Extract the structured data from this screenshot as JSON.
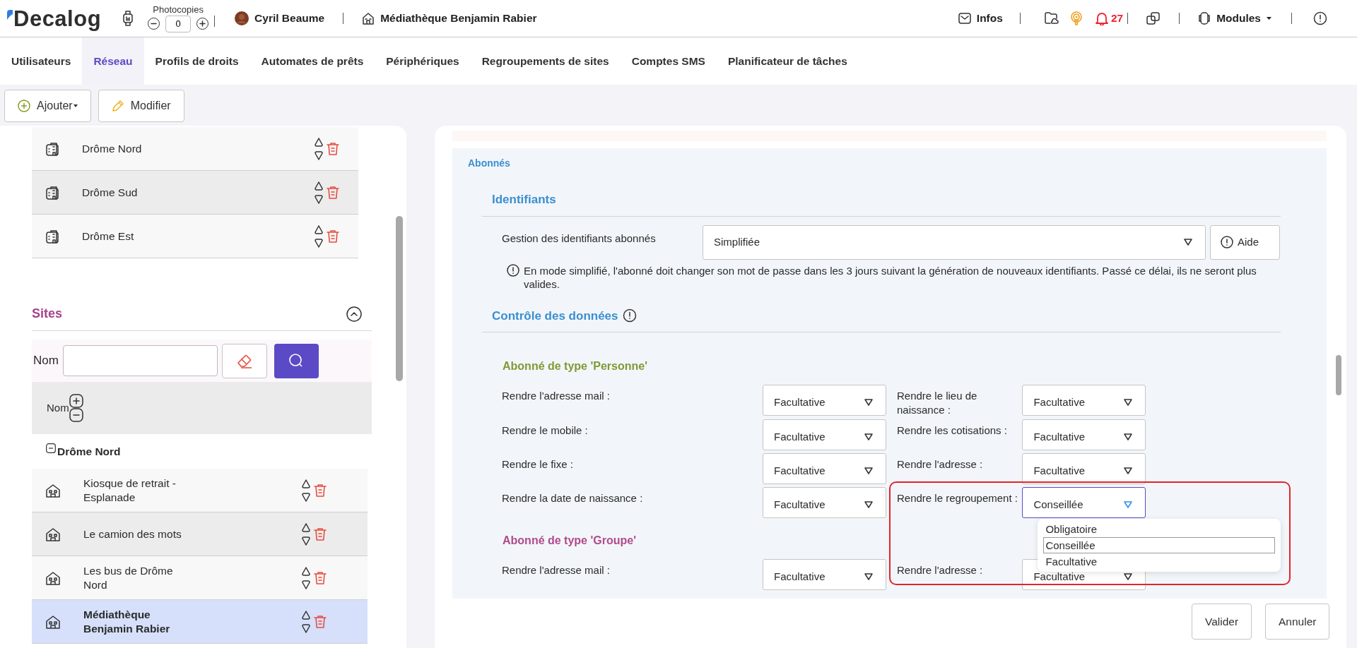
{
  "header": {
    "logo": "Decalog",
    "photocopies": {
      "label": "Photocopies",
      "value": "0"
    },
    "user": "Cyril Beaume",
    "site": "Médiathèque Benjamin Rabier",
    "infos": "Infos",
    "notifications": "27",
    "modules": "Modules"
  },
  "tabs": [
    {
      "label": "Utilisateurs",
      "selected": false
    },
    {
      "label": "Réseau",
      "selected": true
    },
    {
      "label": "Profils de droits",
      "selected": false
    },
    {
      "label": "Automates de prêts",
      "selected": false
    },
    {
      "label": "Périphériques",
      "selected": false
    },
    {
      "label": "Regroupements de sites",
      "selected": false
    },
    {
      "label": "Comptes SMS",
      "selected": false
    },
    {
      "label": "Planificateur de tâches",
      "selected": false
    }
  ],
  "toolbar": [
    {
      "kind": "add",
      "label": "Ajouter",
      "dropdown": true
    },
    {
      "kind": "edit",
      "label": "Modifier",
      "dropdown": false
    }
  ],
  "regroupements": [
    {
      "name": "Drôme Nord"
    },
    {
      "name": "Drôme Sud"
    },
    {
      "name": "Drôme Est"
    }
  ],
  "sites": {
    "title": "Sites",
    "expanded": true,
    "search_label": "Nom",
    "column": "Nom",
    "group": {
      "name": "Drôme Nord",
      "expanded": true
    },
    "items": [
      {
        "name": "Kiosque de retrait - Esplanade",
        "selected": false
      },
      {
        "name": "Le camion des mots",
        "selected": false
      },
      {
        "name": "Les bus de Drôme Nord",
        "selected": false
      },
      {
        "name": "Médiathèque Benjamin Rabier",
        "selected": true
      }
    ]
  },
  "form": {
    "section": "Abonnés",
    "identifiants": {
      "title": "Identifiants",
      "label": "Gestion des identifiants abonnés",
      "value": "Simplifiée",
      "help": "Aide",
      "note": "En mode simplifié, l'abonné doit changer son mot de passe dans les 3 jours suivant la génération de nouveaux identifiants. Passé ce délai, ils ne seront plus valides."
    },
    "controle": {
      "title": "Contrôle des données"
    },
    "groups": [
      {
        "title": "Abonné de type 'Personne'",
        "color": "#7f9a35",
        "fields": [
          {
            "label": "Rendre l'adresse mail :",
            "value": "Facultative",
            "open": false
          },
          {
            "label": "Rendre le lieu de naissance :",
            "value": "Facultative",
            "open": false
          },
          {
            "label": "Rendre le mobile :",
            "value": "Facultative",
            "open": false
          },
          {
            "label": "Rendre les cotisations :",
            "value": "Facultative",
            "open": false
          },
          {
            "label": "Rendre le fixe :",
            "value": "Facultative",
            "open": false
          },
          {
            "label": "Rendre l'adresse :",
            "value": "Facultative",
            "open": false
          },
          {
            "label": "Rendre la date de naissance :",
            "value": "Facultative",
            "open": false
          },
          {
            "label": "Rendre le regroupement :",
            "value": "Conseillée",
            "open": true,
            "highlighted": true,
            "options": [
              {
                "label": "Obligatoire",
                "selected": false
              },
              {
                "label": "Conseillée",
                "selected": true
              },
              {
                "label": "Facultative",
                "selected": false
              }
            ]
          }
        ]
      },
      {
        "title": "Abonné de type 'Groupe'",
        "color": "#b04a8c",
        "fields": [
          {
            "label": "Rendre l'adresse mail :",
            "value": "Facultative",
            "open": false
          },
          {
            "label": "Rendre l'adresse :",
            "value": "Facultative",
            "open": false
          }
        ]
      }
    ]
  },
  "actions": [
    "Valider",
    "Annuler"
  ]
}
